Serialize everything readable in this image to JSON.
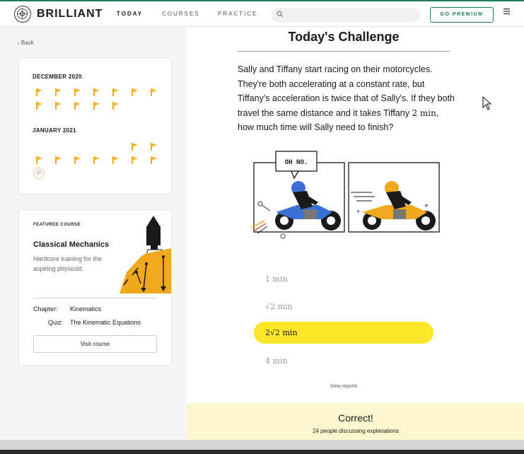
{
  "brand": {
    "name": "BRILLIANT"
  },
  "nav": {
    "today": "TODAY",
    "courses": "COURSES",
    "practice": "PRACTICE"
  },
  "header": {
    "premium_label": "GO PREMIUM",
    "search_placeholder": ""
  },
  "sidebar": {
    "back_label": "Back",
    "calendar": {
      "months": [
        {
          "label": "DECEMBER 2020"
        },
        {
          "label": "JANUARY 2021"
        }
      ],
      "current_day": "10"
    },
    "featured": {
      "section_label": "FEATURED COURSE",
      "title": "Classical Mechanics",
      "description": "Hardcore training for the aspiring physicist.",
      "chapter_key": "Chapter:",
      "chapter_value": "Kinematics",
      "quiz_key": "Quiz:",
      "quiz_value": "The Kinematic Equations",
      "visit_label": "Visit course"
    }
  },
  "challenge": {
    "title": "Today's Challenge",
    "problem_before": "Sally and Tiffany start racing on their motorcycles. They're both accelerating at a constant rate, but Tiffany's acceleration is twice that of Sally's. If they both travel the same distance and it takes Tiffany ",
    "problem_math": "2 min,",
    "problem_after": " how much time will Sally need to finish?",
    "speech_bubble": "OH NO.",
    "options": [
      "1 min",
      "√2 min",
      "2√2 min",
      "4 min"
    ],
    "selected_index": 2,
    "view_reports_label": "View reports"
  },
  "result": {
    "title": "Correct!",
    "subtitle": "24 people discussing explanations"
  },
  "colors": {
    "brand_green": "#1d7d63",
    "flag_gold": "#f5b731",
    "selected_yellow": "#fde62a",
    "banner_cream": "#fdf7cf",
    "bike_blue": "#3b6fd4",
    "bike_orange": "#f0a91f"
  },
  "icons": {
    "logo": "brilliant-logo-icon",
    "search": "search-icon",
    "menu": "hamburger-menu-icon",
    "back": "chevron-left-icon",
    "flag": "flag-icon",
    "cursor": "mouse-cursor-icon"
  }
}
